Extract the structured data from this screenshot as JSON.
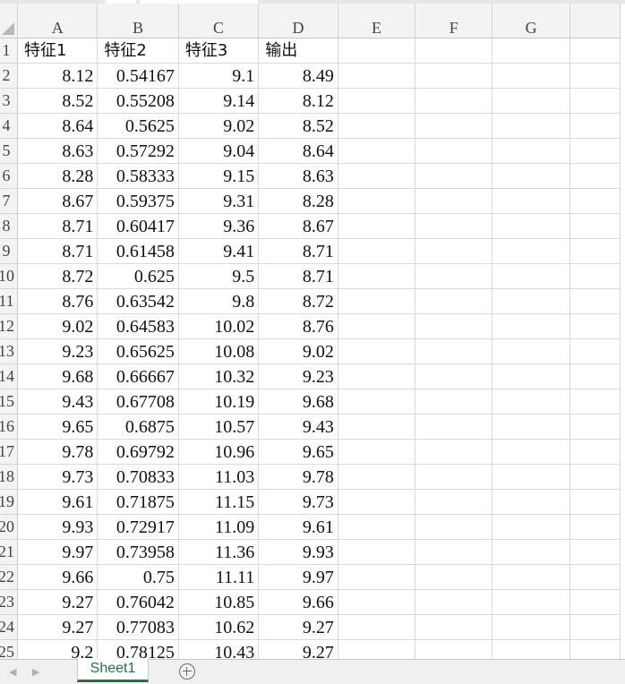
{
  "columns": [
    "A",
    "B",
    "C",
    "D",
    "E",
    "F",
    "G"
  ],
  "rows": [
    {
      "num": "1",
      "cells": [
        "特征1",
        "特征2",
        "特征3",
        "输出"
      ]
    },
    {
      "num": "2",
      "cells": [
        "8.12",
        "0.54167",
        "9.1",
        "8.49"
      ]
    },
    {
      "num": "3",
      "cells": [
        "8.52",
        "0.55208",
        "9.14",
        "8.12"
      ]
    },
    {
      "num": "4",
      "cells": [
        "8.64",
        "0.5625",
        "9.02",
        "8.52"
      ]
    },
    {
      "num": "5",
      "cells": [
        "8.63",
        "0.57292",
        "9.04",
        "8.64"
      ]
    },
    {
      "num": "6",
      "cells": [
        "8.28",
        "0.58333",
        "9.15",
        "8.63"
      ]
    },
    {
      "num": "7",
      "cells": [
        "8.67",
        "0.59375",
        "9.31",
        "8.28"
      ]
    },
    {
      "num": "8",
      "cells": [
        "8.71",
        "0.60417",
        "9.36",
        "8.67"
      ]
    },
    {
      "num": "9",
      "cells": [
        "8.71",
        "0.61458",
        "9.41",
        "8.71"
      ]
    },
    {
      "num": "10",
      "cells": [
        "8.72",
        "0.625",
        "9.5",
        "8.71"
      ]
    },
    {
      "num": "11",
      "cells": [
        "8.76",
        "0.63542",
        "9.8",
        "8.72"
      ]
    },
    {
      "num": "12",
      "cells": [
        "9.02",
        "0.64583",
        "10.02",
        "8.76"
      ]
    },
    {
      "num": "13",
      "cells": [
        "9.23",
        "0.65625",
        "10.08",
        "9.02"
      ]
    },
    {
      "num": "14",
      "cells": [
        "9.68",
        "0.66667",
        "10.32",
        "9.23"
      ]
    },
    {
      "num": "15",
      "cells": [
        "9.43",
        "0.67708",
        "10.19",
        "9.68"
      ]
    },
    {
      "num": "16",
      "cells": [
        "9.65",
        "0.6875",
        "10.57",
        "9.43"
      ]
    },
    {
      "num": "17",
      "cells": [
        "9.78",
        "0.69792",
        "10.96",
        "9.65"
      ]
    },
    {
      "num": "18",
      "cells": [
        "9.73",
        "0.70833",
        "11.03",
        "9.78"
      ]
    },
    {
      "num": "19",
      "cells": [
        "9.61",
        "0.71875",
        "11.15",
        "9.73"
      ]
    },
    {
      "num": "20",
      "cells": [
        "9.93",
        "0.72917",
        "11.09",
        "9.61"
      ]
    },
    {
      "num": "21",
      "cells": [
        "9.97",
        "0.73958",
        "11.36",
        "9.93"
      ]
    },
    {
      "num": "22",
      "cells": [
        "9.66",
        "0.75",
        "11.11",
        "9.97"
      ]
    },
    {
      "num": "23",
      "cells": [
        "9.27",
        "0.76042",
        "10.85",
        "9.66"
      ]
    },
    {
      "num": "24",
      "cells": [
        "9.27",
        "0.77083",
        "10.62",
        "9.27"
      ]
    },
    {
      "num": "25",
      "cells": [
        "9.2",
        "0.78125",
        "10.43",
        "9.27"
      ]
    }
  ],
  "sheet_tabs": [
    {
      "label": "Sheet1",
      "active": true
    }
  ],
  "icons": {
    "nav_prev": "triangle-left-icon",
    "nav_next": "triangle-right-icon",
    "add_sheet": "plus-circle-icon"
  },
  "colors": {
    "accent": "#217346",
    "header_bg": "#f3f3f3",
    "gridline": "#dadada"
  }
}
